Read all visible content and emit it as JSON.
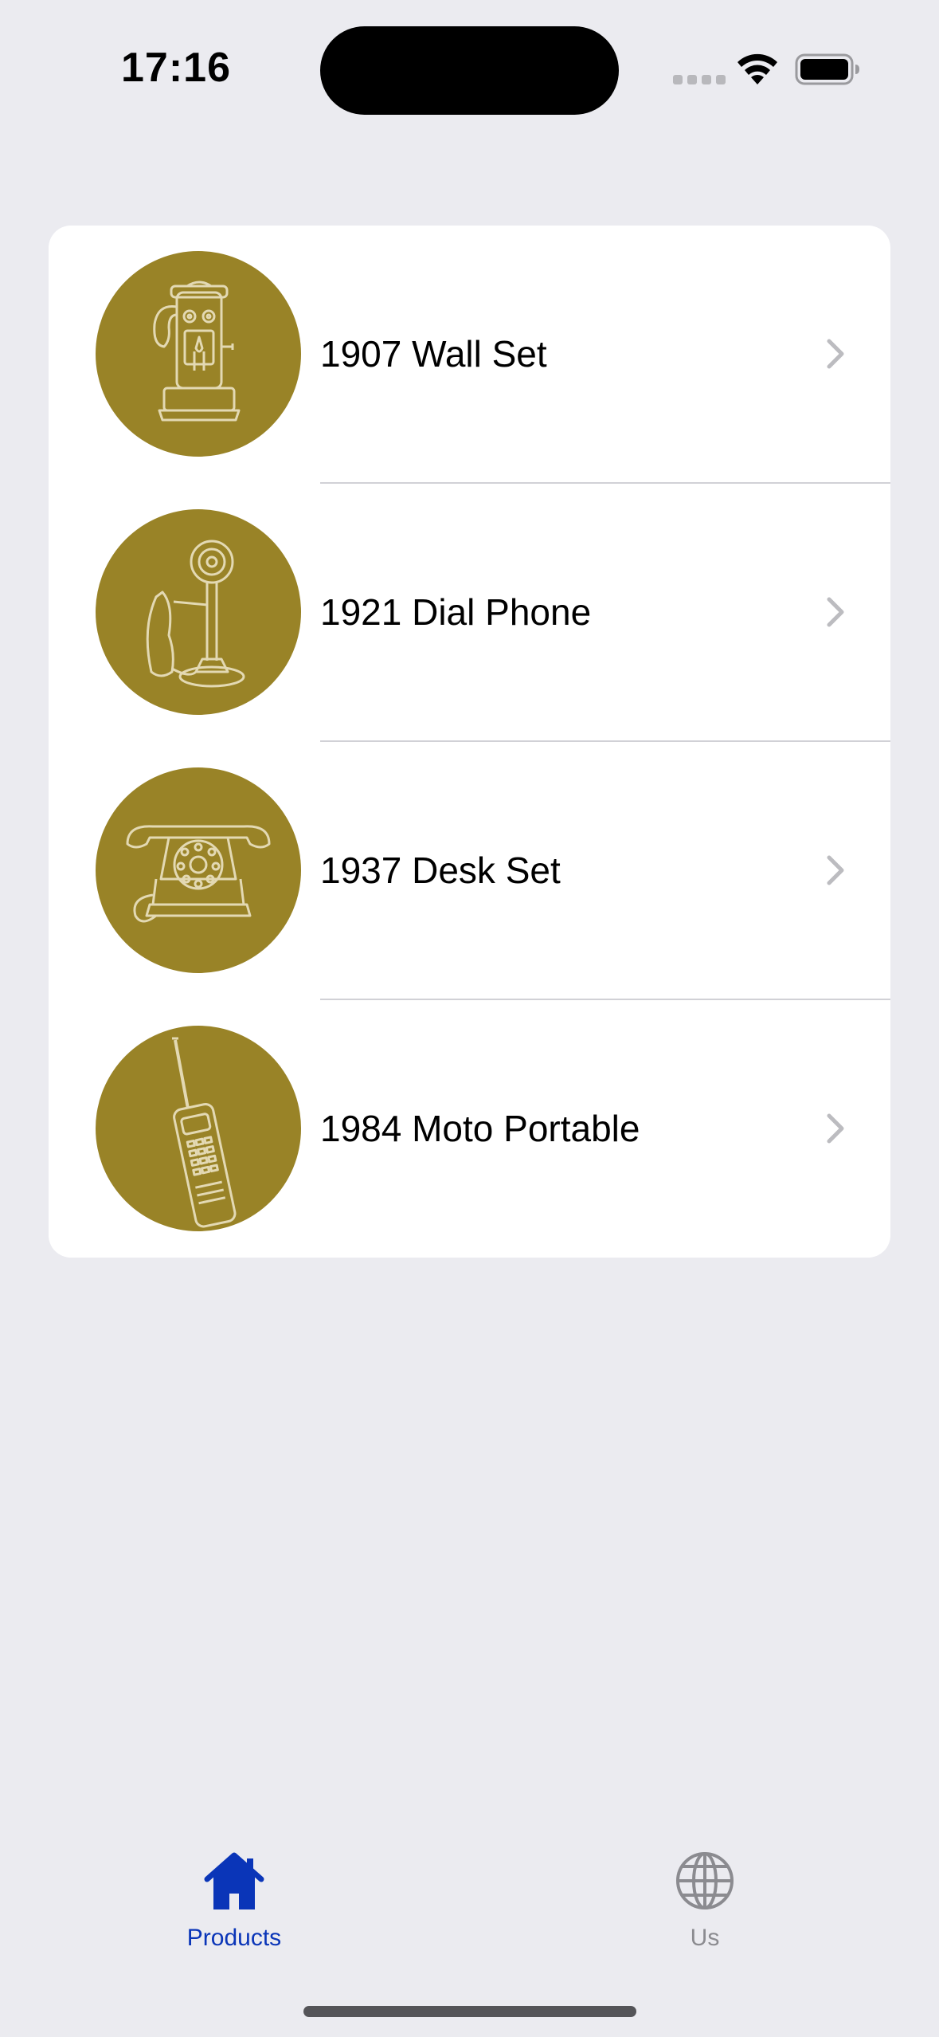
{
  "status_bar": {
    "time": "17:16"
  },
  "products": [
    {
      "label": "1907 Wall Set",
      "icon": "wall-telephone-icon"
    },
    {
      "label": "1921 Dial Phone",
      "icon": "candlestick-phone-icon"
    },
    {
      "label": "1937 Desk Set",
      "icon": "rotary-desk-phone-icon"
    },
    {
      "label": "1984 Moto Portable",
      "icon": "brick-mobile-phone-icon"
    }
  ],
  "tab_bar": {
    "tabs": [
      {
        "label": "Products",
        "icon": "house-icon",
        "selected": true
      },
      {
        "label": "Us",
        "icon": "globe-icon",
        "selected": false
      }
    ]
  },
  "colors": {
    "background": "#ebebf0",
    "card": "#ffffff",
    "thumb": "#998327",
    "accent": "#0a35b8",
    "inactive": "#8b8b90"
  }
}
